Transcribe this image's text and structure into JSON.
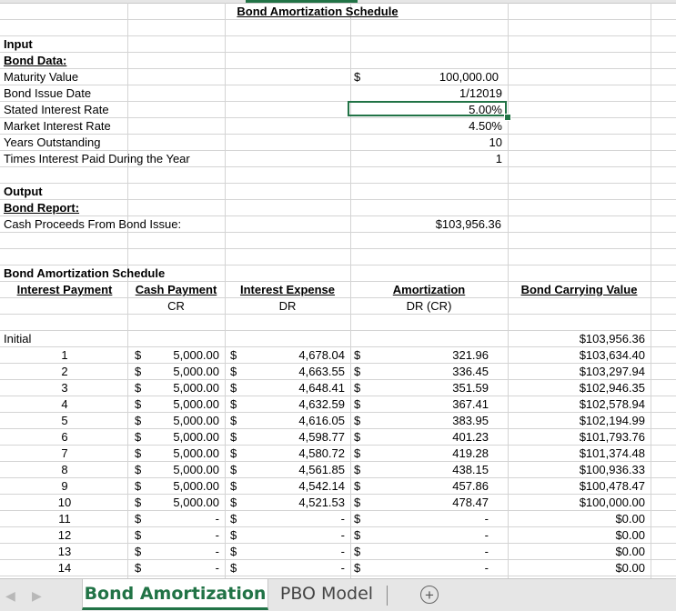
{
  "title": "Bond Amortization Schedule",
  "input": {
    "heading": "Input",
    "subheading": "Bond Data:",
    "fields": [
      {
        "label": "Maturity Value",
        "currency": "$",
        "value": "100,000.00"
      },
      {
        "label": "Bond Issue Date",
        "currency": "",
        "value": "1/12019"
      },
      {
        "label": "Stated Interest Rate",
        "currency": "",
        "value": "5.00%"
      },
      {
        "label": "Market Interest Rate",
        "currency": "",
        "value": "4.50%"
      },
      {
        "label": "Years Outstanding",
        "currency": "",
        "value": "10"
      },
      {
        "label": "Times Interest Paid During the Year",
        "currency": "",
        "value": "1"
      }
    ]
  },
  "output": {
    "heading": "Output",
    "subheading": "Bond Report:",
    "cash_proceeds_label": "Cash Proceeds From Bond Issue:",
    "cash_proceeds_value": "$103,956.36"
  },
  "schedule": {
    "heading": "Bond Amortization Schedule",
    "columns": [
      "Interest Payment",
      "Cash Payment",
      "Interest Expense",
      "Amortization",
      "Bond Carrying Value"
    ],
    "subcolumns": [
      "",
      "CR",
      "DR",
      "DR (CR)",
      ""
    ],
    "initial_label": "Initial",
    "initial_value": "$103,956.36",
    "currency_symbol": "$",
    "rows": [
      {
        "n": "1",
        "cash": "5,000.00",
        "interest": "4,678.04",
        "amort": "321.96",
        "carrying": "$103,634.40"
      },
      {
        "n": "2",
        "cash": "5,000.00",
        "interest": "4,663.55",
        "amort": "336.45",
        "carrying": "$103,297.94"
      },
      {
        "n": "3",
        "cash": "5,000.00",
        "interest": "4,648.41",
        "amort": "351.59",
        "carrying": "$102,946.35"
      },
      {
        "n": "4",
        "cash": "5,000.00",
        "interest": "4,632.59",
        "amort": "367.41",
        "carrying": "$102,578.94"
      },
      {
        "n": "5",
        "cash": "5,000.00",
        "interest": "4,616.05",
        "amort": "383.95",
        "carrying": "$102,194.99"
      },
      {
        "n": "6",
        "cash": "5,000.00",
        "interest": "4,598.77",
        "amort": "401.23",
        "carrying": "$101,793.76"
      },
      {
        "n": "7",
        "cash": "5,000.00",
        "interest": "4,580.72",
        "amort": "419.28",
        "carrying": "$101,374.48"
      },
      {
        "n": "8",
        "cash": "5,000.00",
        "interest": "4,561.85",
        "amort": "438.15",
        "carrying": "$100,936.33"
      },
      {
        "n": "9",
        "cash": "5,000.00",
        "interest": "4,542.14",
        "amort": "457.86",
        "carrying": "$100,478.47"
      },
      {
        "n": "10",
        "cash": "5,000.00",
        "interest": "4,521.53",
        "amort": "478.47",
        "carrying": "$100,000.00"
      },
      {
        "n": "11",
        "cash": "-",
        "interest": "-",
        "amort": "-",
        "carrying": "$0.00"
      },
      {
        "n": "12",
        "cash": "-",
        "interest": "-",
        "amort": "-",
        "carrying": "$0.00"
      },
      {
        "n": "13",
        "cash": "-",
        "interest": "-",
        "amort": "-",
        "carrying": "$0.00"
      },
      {
        "n": "14",
        "cash": "-",
        "interest": "-",
        "amort": "-",
        "carrying": "$0.00"
      }
    ]
  },
  "sheet_tabs": {
    "active": "Bond Amortization",
    "other": "PBO Model",
    "add_icon": "plus-circle-icon"
  },
  "colors": {
    "accent": "#217346",
    "gridline": "#d4d4d4"
  }
}
